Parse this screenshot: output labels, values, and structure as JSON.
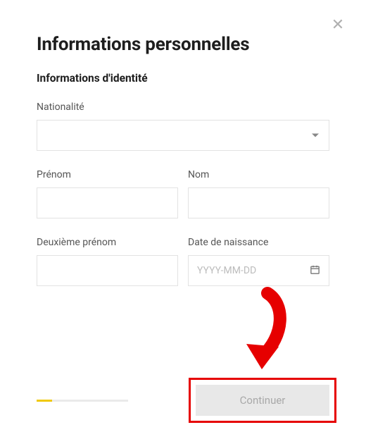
{
  "header": {
    "title": "Informations personnelles",
    "section_title": "Informations d'identité"
  },
  "fields": {
    "nationality": {
      "label": "Nationalité",
      "value": ""
    },
    "first_name": {
      "label": "Prénom",
      "value": ""
    },
    "last_name": {
      "label": "Nom",
      "value": ""
    },
    "middle_name": {
      "label": "Deuxième prénom",
      "value": ""
    },
    "dob": {
      "label": "Date de naissance",
      "placeholder": "YYYY-MM-DD",
      "value": ""
    }
  },
  "footer": {
    "continue_label": "Continuer"
  },
  "colors": {
    "accent": "#f0c90a",
    "highlight": "#e60000"
  }
}
